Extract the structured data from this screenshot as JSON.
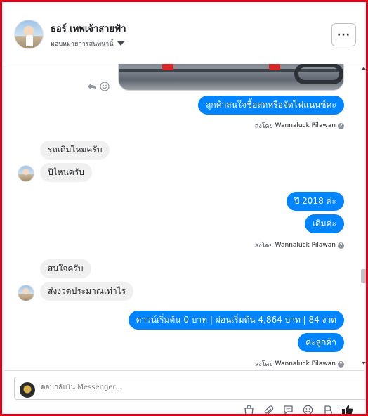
{
  "header": {
    "page_name": "ธอร์ เทพเจ้าสายฟ้า",
    "assign_label": "มอบหมายการสนทนานี้",
    "more_label": "···"
  },
  "messages": [
    {
      "id": "m1",
      "direction": "out",
      "text": "ลูกค้าสนใจซื้อสดหรือจัดไฟแนนซ์คะ"
    },
    {
      "id": "m2",
      "direction": "in",
      "text": "รถเดิมไหมครับ"
    },
    {
      "id": "m3",
      "direction": "in",
      "text": "ปีไหนครับ"
    },
    {
      "id": "m4",
      "direction": "out",
      "text": "ปี 2018  ค่ะ"
    },
    {
      "id": "m5",
      "direction": "out",
      "text": "เดิมค่ะ"
    },
    {
      "id": "m6",
      "direction": "in",
      "text": "สนใจครับ"
    },
    {
      "id": "m7",
      "direction": "in",
      "text": "ส่งงวดประมาณเท่าไร"
    },
    {
      "id": "m8",
      "direction": "out",
      "text": "ดาวน์เริ่มต้น 0 บาท | ผ่อนเริ่มต้น 4,864 บาท | 84 งวด"
    },
    {
      "id": "m9",
      "direction": "out",
      "text": "ค่ะลูกค้า"
    }
  ],
  "sent_by": {
    "prefix": "ส่งโดย",
    "name": "Wannaluck Pilawan",
    "help": "?"
  },
  "composer": {
    "placeholder": "ตอบกลับใน Messenger..."
  },
  "icons": {
    "reply": "reply-icon",
    "reaction": "smile-icon",
    "more": "more-icon",
    "dropdown": "caret-down-icon",
    "tools": [
      "shopping-bag-icon",
      "attachment-icon",
      "saved-reply-icon",
      "emoji-icon",
      "payment-icon",
      "like-icon"
    ]
  },
  "colors": {
    "accent": "#0084ff",
    "incoming_bubble": "#f0f0f0",
    "frame_border": "#e3001b"
  }
}
